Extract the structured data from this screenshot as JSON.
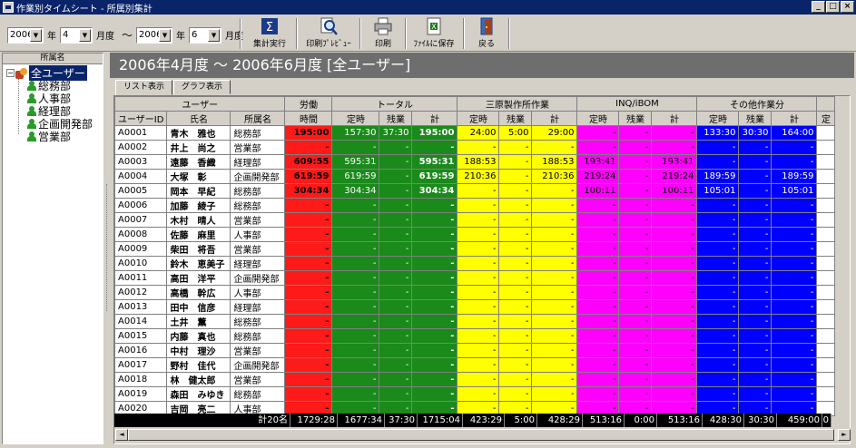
{
  "window": {
    "title": "作業別タイムシート - 所属別集計",
    "min": "_",
    "max": "□",
    "close": "×"
  },
  "toolbar": {
    "from_year": "2006",
    "year_label1": "年",
    "from_month": "4",
    "month_label1": "月度",
    "tilde": "〜",
    "to_year": "2006",
    "year_label2": "年",
    "to_month": "6",
    "month_label2": "月度",
    "run_label": "集計実行",
    "preview_label": "印刷ﾌﾟﾚﾋﾞｭｰ",
    "print_label": "印刷",
    "save_label": "ﾌｧｲﾙに保存",
    "back_label": "戻る"
  },
  "tree": {
    "header": "所属名",
    "root": "全ユーザー",
    "expander": "−",
    "items": [
      "総務部",
      "人事部",
      "経理部",
      "企画開発部",
      "営業部"
    ]
  },
  "banner": "2006年4月度 〜 2006年6月度 [全ユーザー]",
  "tabs": [
    "リスト表示",
    "グラフ表示"
  ],
  "headers": {
    "user_group": "ユーザー",
    "labor_group": "労働",
    "total_group": "トータル",
    "mihara_group": "三原製作所作業",
    "inq_group": "INQ/iBOM",
    "other_group": "その他作業分",
    "user_id": "ユーザーID",
    "name": "氏名",
    "dept": "所属名",
    "hours": "時間",
    "regular": "定時",
    "overtime": "残業",
    "sum": "計",
    "extra": "定"
  },
  "rows": [
    {
      "id": "A0001",
      "name": "青木　雅也",
      "dept": "総務部",
      "labor": "195:00",
      "t_reg": "157:30",
      "t_ot": "37:30",
      "t_sum": "195:00",
      "m_reg": "24:00",
      "m_ot": "5:00",
      "m_sum": "29:00",
      "i_reg": "-",
      "i_ot": "-",
      "i_sum": "-",
      "o_reg": "133:30",
      "o_ot": "30:30",
      "o_sum": "164:00"
    },
    {
      "id": "A0002",
      "name": "井上　尚之",
      "dept": "営業部",
      "labor": "-",
      "t_reg": "-",
      "t_ot": "-",
      "t_sum": "-",
      "m_reg": "-",
      "m_ot": "-",
      "m_sum": "-",
      "i_reg": "-",
      "i_ot": "-",
      "i_sum": "-",
      "o_reg": "-",
      "o_ot": "-",
      "o_sum": "-"
    },
    {
      "id": "A0003",
      "name": "遠藤　香織",
      "dept": "経理部",
      "labor": "609:55",
      "t_reg": "595:31",
      "t_ot": "-",
      "t_sum": "595:31",
      "m_reg": "188:53",
      "m_ot": "-",
      "m_sum": "188:53",
      "i_reg": "193:41",
      "i_ot": "-",
      "i_sum": "193:41",
      "o_reg": "-",
      "o_ot": "-",
      "o_sum": "-"
    },
    {
      "id": "A0004",
      "name": "大塚　彰",
      "dept": "企画開発部",
      "labor": "619:59",
      "t_reg": "619:59",
      "t_ot": "-",
      "t_sum": "619:59",
      "m_reg": "210:36",
      "m_ot": "-",
      "m_sum": "210:36",
      "i_reg": "219:24",
      "i_ot": "-",
      "i_sum": "219:24",
      "o_reg": "189:59",
      "o_ot": "-",
      "o_sum": "189:59"
    },
    {
      "id": "A0005",
      "name": "岡本　早紀",
      "dept": "総務部",
      "labor": "304:34",
      "t_reg": "304:34",
      "t_ot": "-",
      "t_sum": "304:34",
      "m_reg": "-",
      "m_ot": "-",
      "m_sum": "-",
      "i_reg": "100:11",
      "i_ot": "-",
      "i_sum": "100:11",
      "o_reg": "105:01",
      "o_ot": "-",
      "o_sum": "105:01"
    },
    {
      "id": "A0006",
      "name": "加藤　綾子",
      "dept": "総務部",
      "labor": "-",
      "t_reg": "-",
      "t_ot": "-",
      "t_sum": "-",
      "m_reg": "-",
      "m_ot": "-",
      "m_sum": "-",
      "i_reg": "-",
      "i_ot": "-",
      "i_sum": "-",
      "o_reg": "-",
      "o_ot": "-",
      "o_sum": "-"
    },
    {
      "id": "A0007",
      "name": "木村　晴人",
      "dept": "営業部",
      "labor": "-",
      "t_reg": "-",
      "t_ot": "-",
      "t_sum": "-",
      "m_reg": "-",
      "m_ot": "-",
      "m_sum": "-",
      "i_reg": "-",
      "i_ot": "-",
      "i_sum": "-",
      "o_reg": "-",
      "o_ot": "-",
      "o_sum": "-"
    },
    {
      "id": "A0008",
      "name": "佐藤　麻里",
      "dept": "人事部",
      "labor": "-",
      "t_reg": "-",
      "t_ot": "-",
      "t_sum": "-",
      "m_reg": "-",
      "m_ot": "-",
      "m_sum": "-",
      "i_reg": "-",
      "i_ot": "-",
      "i_sum": "-",
      "o_reg": "-",
      "o_ot": "-",
      "o_sum": "-"
    },
    {
      "id": "A0009",
      "name": "柴田　将吾",
      "dept": "営業部",
      "labor": "-",
      "t_reg": "-",
      "t_ot": "-",
      "t_sum": "-",
      "m_reg": "-",
      "m_ot": "-",
      "m_sum": "-",
      "i_reg": "-",
      "i_ot": "-",
      "i_sum": "-",
      "o_reg": "-",
      "o_ot": "-",
      "o_sum": "-"
    },
    {
      "id": "A0010",
      "name": "鈴木　恵美子",
      "dept": "経理部",
      "labor": "-",
      "t_reg": "-",
      "t_ot": "-",
      "t_sum": "-",
      "m_reg": "-",
      "m_ot": "-",
      "m_sum": "-",
      "i_reg": "-",
      "i_ot": "-",
      "i_sum": "-",
      "o_reg": "-",
      "o_ot": "-",
      "o_sum": "-"
    },
    {
      "id": "A0011",
      "name": "高田　洋平",
      "dept": "企画開発部",
      "labor": "-",
      "t_reg": "-",
      "t_ot": "-",
      "t_sum": "-",
      "m_reg": "-",
      "m_ot": "-",
      "m_sum": "-",
      "i_reg": "-",
      "i_ot": "-",
      "i_sum": "-",
      "o_reg": "-",
      "o_ot": "-",
      "o_sum": "-"
    },
    {
      "id": "A0012",
      "name": "高橋　幹広",
      "dept": "人事部",
      "labor": "-",
      "t_reg": "-",
      "t_ot": "-",
      "t_sum": "-",
      "m_reg": "-",
      "m_ot": "-",
      "m_sum": "-",
      "i_reg": "-",
      "i_ot": "-",
      "i_sum": "-",
      "o_reg": "-",
      "o_ot": "-",
      "o_sum": "-"
    },
    {
      "id": "A0013",
      "name": "田中　信彦",
      "dept": "経理部",
      "labor": "-",
      "t_reg": "-",
      "t_ot": "-",
      "t_sum": "-",
      "m_reg": "-",
      "m_ot": "-",
      "m_sum": "-",
      "i_reg": "-",
      "i_ot": "-",
      "i_sum": "-",
      "o_reg": "-",
      "o_ot": "-",
      "o_sum": "-"
    },
    {
      "id": "A0014",
      "name": "土井　薫",
      "dept": "総務部",
      "labor": "-",
      "t_reg": "-",
      "t_ot": "-",
      "t_sum": "-",
      "m_reg": "-",
      "m_ot": "-",
      "m_sum": "-",
      "i_reg": "-",
      "i_ot": "-",
      "i_sum": "-",
      "o_reg": "-",
      "o_ot": "-",
      "o_sum": "-"
    },
    {
      "id": "A0015",
      "name": "内藤　真也",
      "dept": "総務部",
      "labor": "-",
      "t_reg": "-",
      "t_ot": "-",
      "t_sum": "-",
      "m_reg": "-",
      "m_ot": "-",
      "m_sum": "-",
      "i_reg": "-",
      "i_ot": "-",
      "i_sum": "-",
      "o_reg": "-",
      "o_ot": "-",
      "o_sum": "-"
    },
    {
      "id": "A0016",
      "name": "中村　理沙",
      "dept": "営業部",
      "labor": "-",
      "t_reg": "-",
      "t_ot": "-",
      "t_sum": "-",
      "m_reg": "-",
      "m_ot": "-",
      "m_sum": "-",
      "i_reg": "-",
      "i_ot": "-",
      "i_sum": "-",
      "o_reg": "-",
      "o_ot": "-",
      "o_sum": "-"
    },
    {
      "id": "A0017",
      "name": "野村　佳代",
      "dept": "企画開発部",
      "labor": "-",
      "t_reg": "-",
      "t_ot": "-",
      "t_sum": "-",
      "m_reg": "-",
      "m_ot": "-",
      "m_sum": "-",
      "i_reg": "-",
      "i_ot": "-",
      "i_sum": "-",
      "o_reg": "-",
      "o_ot": "-",
      "o_sum": "-"
    },
    {
      "id": "A0018",
      "name": "林　健太郎",
      "dept": "営業部",
      "labor": "-",
      "t_reg": "-",
      "t_ot": "-",
      "t_sum": "-",
      "m_reg": "-",
      "m_ot": "-",
      "m_sum": "-",
      "i_reg": "-",
      "i_ot": "-",
      "i_sum": "-",
      "o_reg": "-",
      "o_ot": "-",
      "o_sum": "-"
    },
    {
      "id": "A0019",
      "name": "森田　みゆき",
      "dept": "総務部",
      "labor": "-",
      "t_reg": "-",
      "t_ot": "-",
      "t_sum": "-",
      "m_reg": "-",
      "m_ot": "-",
      "m_sum": "-",
      "i_reg": "-",
      "i_ot": "-",
      "i_sum": "-",
      "o_reg": "-",
      "o_ot": "-",
      "o_sum": "-"
    },
    {
      "id": "A0020",
      "name": "吉岡　亮二",
      "dept": "人事部",
      "labor": "-",
      "t_reg": "-",
      "t_ot": "-",
      "t_sum": "-",
      "m_reg": "-",
      "m_ot": "-",
      "m_sum": "-",
      "i_reg": "-",
      "i_ot": "-",
      "i_sum": "-",
      "o_reg": "-",
      "o_ot": "-",
      "o_sum": "-"
    }
  ],
  "totals": {
    "count": "計20名",
    "labor": "1729:28",
    "t_reg": "1677:34",
    "t_ot": "37:30",
    "t_sum": "1715:04",
    "m_reg": "423:29",
    "m_ot": "5:00",
    "m_sum": "428:29",
    "i_reg": "513:16",
    "i_ot": "0:00",
    "i_sum": "513:16",
    "o_reg": "428:30",
    "o_ot": "30:30",
    "o_sum": "459:00",
    "o_extra": "0"
  },
  "scroll": {
    "left": "◄",
    "right": "►"
  },
  "colors": {
    "labor": "#ff1a1a",
    "total": "#1a8a1a",
    "mihara": "#ffff00",
    "inq": "#ff00ff",
    "other": "#0000ff"
  }
}
